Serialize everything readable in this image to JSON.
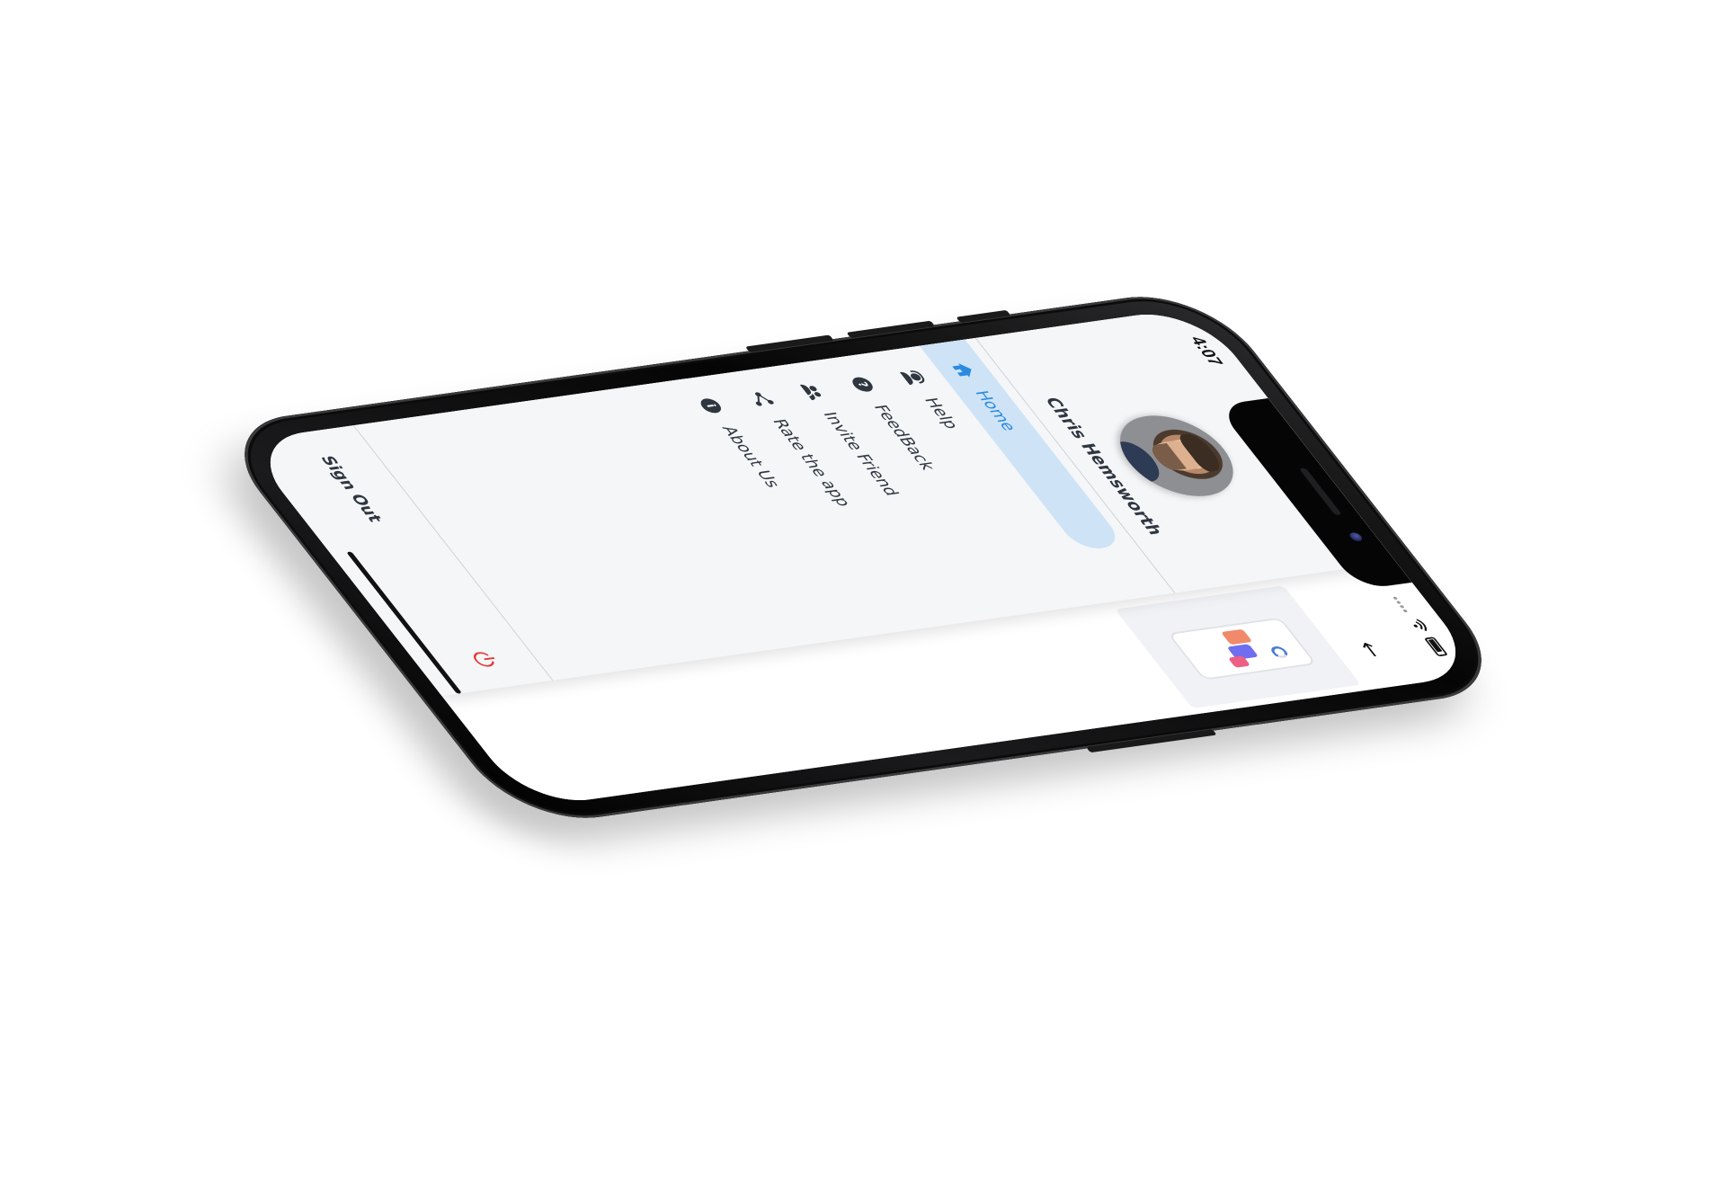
{
  "status_bar": {
    "time": "4:07"
  },
  "drawer": {
    "user_name": "Chris Hemsworth",
    "menu": [
      {
        "label": "Home",
        "icon": "home-icon",
        "active": true
      },
      {
        "label": "Help",
        "icon": "support-agent-icon",
        "active": false
      },
      {
        "label": "FeedBack",
        "icon": "help-circle-icon",
        "active": false
      },
      {
        "label": "Invite Friend",
        "icon": "group-icon",
        "active": false
      },
      {
        "label": "Rate the app",
        "icon": "share-icon",
        "active": false
      },
      {
        "label": "About Us",
        "icon": "info-icon",
        "active": false
      }
    ],
    "sign_out_label": "Sign Out"
  },
  "colors": {
    "drawer_background": "#f4f6f8",
    "active_item_background": "#cfe3f7",
    "active_item_text": "#2a8be0",
    "text_primary": "#2f3640",
    "power_icon": "#e53935",
    "device_frame": "#0b0b0b"
  },
  "icons": {
    "back": "arrow-left-icon",
    "power": "power-icon",
    "wifi": "wifi-icon",
    "battery": "battery-icon"
  }
}
